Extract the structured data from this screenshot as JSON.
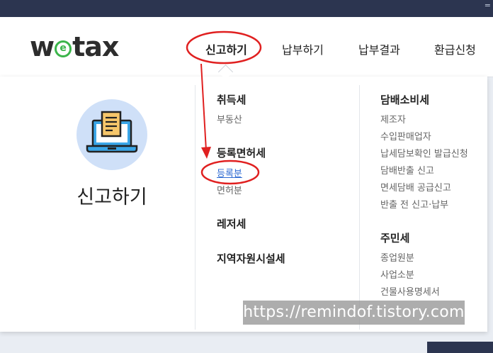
{
  "topbar": {
    "glyph": "="
  },
  "logo": {
    "part1": "w",
    "part2": "e",
    "part3": "tax"
  },
  "nav": [
    {
      "label": "신고하기"
    },
    {
      "label": "납부하기"
    },
    {
      "label": "납부결과"
    },
    {
      "label": "환급신청"
    }
  ],
  "panel": {
    "section_title": "신고하기",
    "section_icon": "laptop-document-icon",
    "colors": {
      "accent": "#2f6bd3",
      "annotation": "#e02020",
      "icon_bg": "#cfe0f8",
      "logo_green": "#3bb54a"
    },
    "col1": [
      {
        "title": "취득세",
        "items": [
          "부동산"
        ]
      },
      {
        "title": "등록면허세",
        "items": [
          "등록분",
          "면허분"
        ],
        "active_item": "등록분"
      },
      {
        "title": "레저세",
        "items": []
      },
      {
        "title": "지역자원시설세",
        "items": []
      }
    ],
    "col2": [
      {
        "title": "담배소비세",
        "items": [
          "제조자",
          "수입판매업자",
          "납세담보확인 발급신청",
          "담배반출 신고",
          "면세담배 공급신고",
          "반출 전 신고·납부"
        ]
      },
      {
        "title": "주민세",
        "items": [
          "종업원분",
          "사업소분",
          "건물사용명세서"
        ]
      }
    ]
  },
  "watermark": "https://remindof.tistory.com"
}
